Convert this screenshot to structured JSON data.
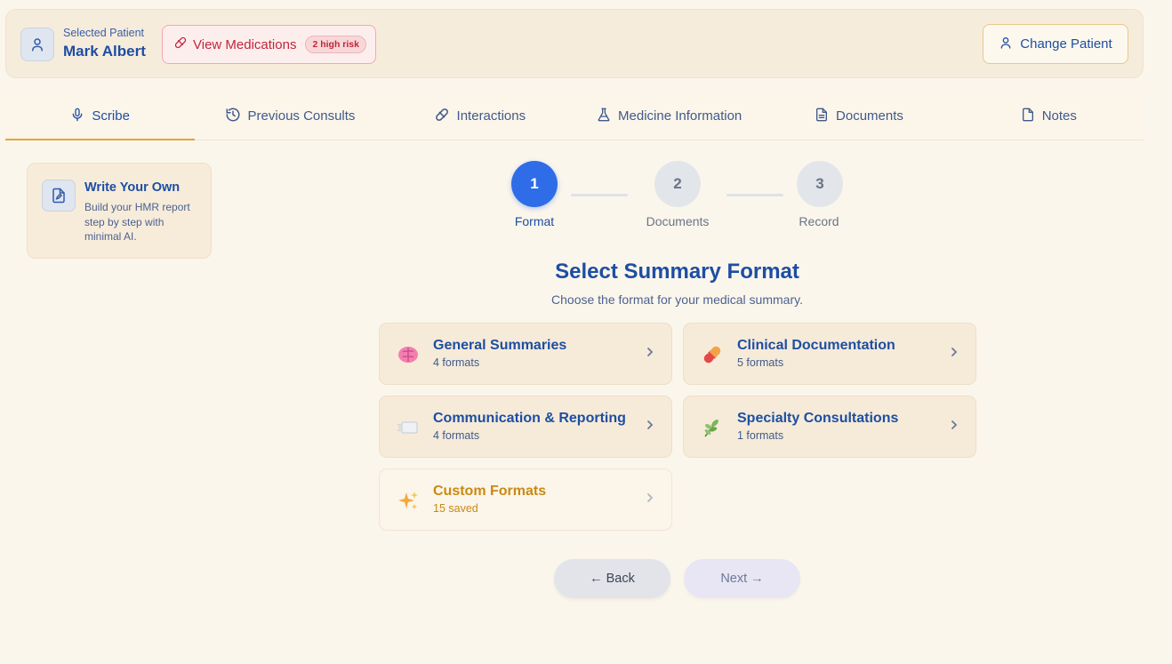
{
  "patient": {
    "label": "Selected Patient",
    "name": "Mark Albert",
    "view_medications_label": "View Medications",
    "risk_badge": "2 high risk",
    "change_patient_label": "Change Patient"
  },
  "tabs": [
    {
      "label": "Scribe",
      "icon": "microphone-icon",
      "active": true
    },
    {
      "label": "Previous Consults",
      "icon": "history-icon",
      "active": false
    },
    {
      "label": "Interactions",
      "icon": "pill-icon",
      "active": false
    },
    {
      "label": "Medicine Information",
      "icon": "flask-icon",
      "active": false
    },
    {
      "label": "Documents",
      "icon": "document-icon",
      "active": false
    },
    {
      "label": "Notes",
      "icon": "note-icon",
      "active": false
    }
  ],
  "sidebar": {
    "title": "Write Your Own",
    "description": "Build your HMR report step by step with minimal AI."
  },
  "stepper": {
    "steps": [
      {
        "number": "1",
        "label": "Format",
        "active": true
      },
      {
        "number": "2",
        "label": "Documents",
        "active": false
      },
      {
        "number": "3",
        "label": "Record",
        "active": false
      }
    ]
  },
  "main": {
    "heading": "Select Summary Format",
    "subheading": "Choose the format for your medical summary."
  },
  "formats": [
    {
      "title": "General Summaries",
      "subtitle": "4 formats",
      "icon": "brain-icon"
    },
    {
      "title": "Clinical Documentation",
      "subtitle": "5 formats",
      "icon": "capsule-icon"
    },
    {
      "title": "Communication & Reporting",
      "subtitle": "4 formats",
      "icon": "paper-icon"
    },
    {
      "title": "Specialty Consultations",
      "subtitle": "1 formats",
      "icon": "herb-icon"
    },
    {
      "title": "Custom Formats",
      "subtitle": "15 saved",
      "icon": "sparkles-icon"
    }
  ],
  "nav": {
    "back_label": "← Back",
    "next_label": "Next →"
  },
  "colors": {
    "primary": "#1d4ea3",
    "accent": "#2f6de8",
    "danger": "#c0263a",
    "highlight": "#e7a33b",
    "background": "#fbf6ec"
  }
}
